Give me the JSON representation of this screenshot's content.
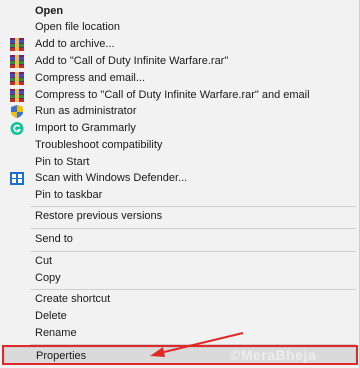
{
  "menu": {
    "items": [
      {
        "label": "Open"
      },
      {
        "label": "Open file location"
      },
      {
        "label": "Add to archive..."
      },
      {
        "label": "Add to \"Call of Duty Infinite Warfare.rar\""
      },
      {
        "label": "Compress and email..."
      },
      {
        "label": "Compress to \"Call of Duty Infinite Warfare.rar\" and email"
      },
      {
        "label": "Run as administrator"
      },
      {
        "label": "Import to Grammarly"
      },
      {
        "label": "Troubleshoot compatibility"
      },
      {
        "label": "Pin to Start"
      },
      {
        "label": "Scan with Windows Defender..."
      },
      {
        "label": "Pin to taskbar"
      },
      {
        "label": "Restore previous versions"
      },
      {
        "label": "Send to"
      },
      {
        "label": "Cut"
      },
      {
        "label": "Copy"
      },
      {
        "label": "Create shortcut"
      },
      {
        "label": "Delete"
      },
      {
        "label": "Rename"
      },
      {
        "label": "Properties"
      }
    ]
  },
  "icons": {
    "winrar": "winrar-icon",
    "shield": "uac-shield-icon",
    "grammarly": "grammarly-icon",
    "defender": "windows-defender-icon"
  },
  "colors": {
    "menu_bg": "#f2f2f2",
    "separator": "#cfcfcf",
    "highlight": "#dadada",
    "annotation": "#e02a2a"
  },
  "watermark": "©MeraBheja"
}
